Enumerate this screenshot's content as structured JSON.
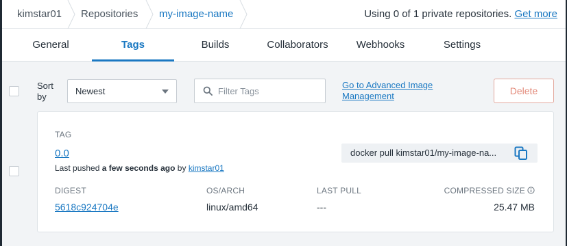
{
  "breadcrumb": {
    "items": [
      {
        "label": "kimstar01"
      },
      {
        "label": "Repositories"
      },
      {
        "label": "my-image-name"
      }
    ]
  },
  "private_repos": {
    "text": "Using 0 of 1 private repositories.",
    "link": "Get more"
  },
  "tabs": [
    {
      "label": "General"
    },
    {
      "label": "Tags",
      "active": true
    },
    {
      "label": "Builds"
    },
    {
      "label": "Collaborators"
    },
    {
      "label": "Webhooks"
    },
    {
      "label": "Settings"
    }
  ],
  "toolbar": {
    "sort_label_1": "Sort",
    "sort_label_2": "by",
    "sort_value": "Newest",
    "filter_placeholder": "Filter Tags",
    "advanced_link_1": "Go to Advanced Image",
    "advanced_link_2": "Management",
    "delete_label": "Delete"
  },
  "tag": {
    "header": "TAG",
    "name": "0.0",
    "pushed_prefix": "Last pushed",
    "pushed_time": "a few seconds ago",
    "pushed_by": "by",
    "pushed_user": "kimstar01",
    "pull_command": "docker pull kimstar01/my-image-na...",
    "columns": {
      "digest": "DIGEST",
      "os_arch": "OS/ARCH",
      "last_pull": "LAST PULL",
      "compressed_size": "COMPRESSED SIZE"
    },
    "row": {
      "digest": "5618c924704e",
      "os_arch": "linux/amd64",
      "last_pull": "---",
      "compressed_size": "25.47 MB"
    }
  },
  "colors": {
    "accent": "#1a78c2",
    "delete": "#e38a7a",
    "background": "#f2f4f6"
  },
  "icons": [
    "search-icon",
    "copy-icon",
    "info-icon",
    "caret-down-icon"
  ]
}
